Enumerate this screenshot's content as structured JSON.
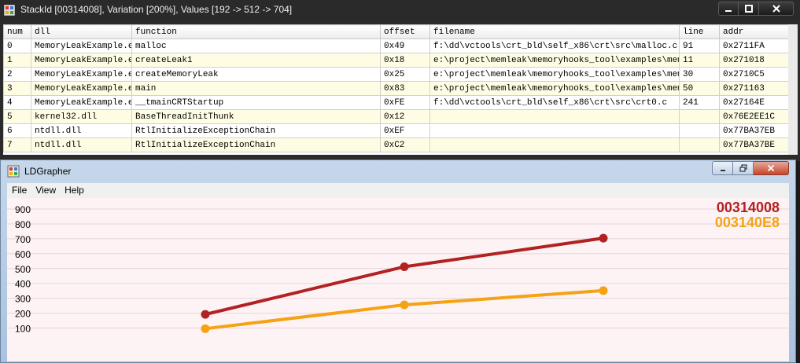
{
  "stack_window": {
    "title": "StackId [00314008],  Variation [200%], Values [192 -> 512 -> 704]",
    "columns": [
      "num",
      "dll",
      "function",
      "offset",
      "filename",
      "line",
      "addr"
    ],
    "rows": [
      [
        "0",
        "MemoryLeakExample.e",
        "malloc",
        "0x49",
        "f:\\dd\\vctools\\crt_bld\\self_x86\\crt\\src\\malloc.c",
        "91",
        "0x2711FA"
      ],
      [
        "1",
        "MemoryLeakExample.e",
        "createLeak1",
        "0x18",
        "e:\\project\\memleak\\memoryhooks_tool\\examples\\memor",
        "11",
        "0x271018"
      ],
      [
        "2",
        "MemoryLeakExample.e",
        "createMemoryLeak",
        "0x25",
        "e:\\project\\memleak\\memoryhooks_tool\\examples\\memor",
        "30",
        "0x2710C5"
      ],
      [
        "3",
        "MemoryLeakExample.e",
        "main",
        "0x83",
        "e:\\project\\memleak\\memoryhooks_tool\\examples\\memor",
        "50",
        "0x271163"
      ],
      [
        "4",
        "MemoryLeakExample.e",
        "__tmainCRTStartup",
        "0xFE",
        "f:\\dd\\vctools\\crt_bld\\self_x86\\crt\\src\\crt0.c",
        "241",
        "0x27164E"
      ],
      [
        "5",
        "kernel32.dll",
        "BaseThreadInitThunk",
        "0x12",
        "",
        "",
        "0x76E2EE1C"
      ],
      [
        "6",
        "ntdll.dll",
        "RtlInitializeExceptionChain",
        "0xEF",
        "",
        "",
        "0x77BA37EB"
      ],
      [
        "7",
        "ntdll.dll",
        "RtlInitializeExceptionChain",
        "0xC2",
        "",
        "",
        "0x77BA37BE"
      ]
    ]
  },
  "grapher_window": {
    "title": "LDGrapher",
    "menu": [
      "File",
      "View",
      "Help"
    ]
  },
  "chart_data": {
    "type": "line",
    "x": [
      1,
      2,
      3
    ],
    "ylim": [
      0,
      900
    ],
    "yticks": [
      100,
      200,
      300,
      400,
      500,
      600,
      700,
      800,
      900
    ],
    "grid": true,
    "legend_position": "top-right",
    "series": [
      {
        "name": "00314008",
        "color": "#b22222",
        "values": [
          192,
          512,
          704
        ]
      },
      {
        "name": "003140E8",
        "color": "#f5a214",
        "values": [
          96,
          256,
          352
        ]
      }
    ],
    "background": "#fdf3f5"
  }
}
